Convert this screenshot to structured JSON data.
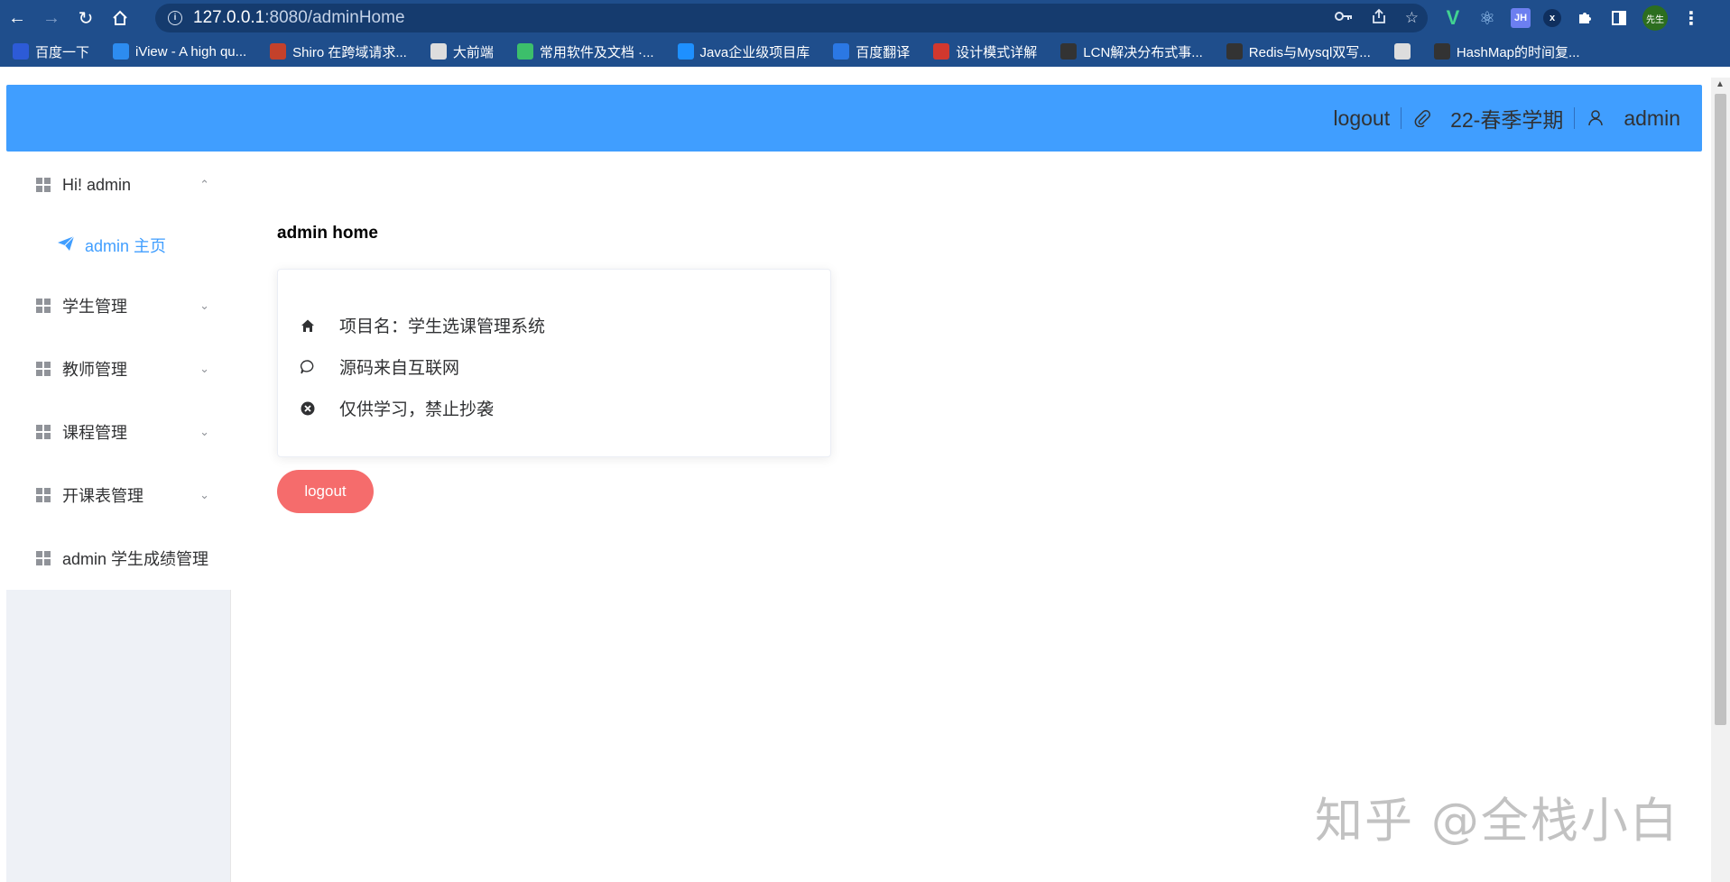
{
  "browser": {
    "url_host": "127.0.0.1",
    "url_rest": ":8080/adminHome",
    "profile_label": "先生",
    "bookmarks": [
      {
        "label": "百度一下",
        "icon": "baidu-icon",
        "color": "#2d5bd7"
      },
      {
        "label": "iView - A high qu...",
        "icon": "iview-icon",
        "color": "#2d8cf0"
      },
      {
        "label": "Shiro 在跨域请求...",
        "icon": "shiro-icon",
        "color": "#c4412b"
      },
      {
        "label": "大前端",
        "icon": "book-icon",
        "color": "#dddddd"
      },
      {
        "label": "常用软件及文档 ·...",
        "icon": "leaf-icon",
        "color": "#3cbf6b"
      },
      {
        "label": "Java企业级项目库",
        "icon": "java-icon",
        "color": "#1e90ff"
      },
      {
        "label": "百度翻译",
        "icon": "translate-icon",
        "color": "#2b78e4"
      },
      {
        "label": "设计模式详解",
        "icon": "c-icon",
        "color": "#d1382e"
      },
      {
        "label": "LCN解决分布式事...",
        "icon": "cnblogs-icon",
        "color": "#333333"
      },
      {
        "label": "Redis与Mysql双写...",
        "icon": "cnblogs-icon",
        "color": "#333333"
      },
      {
        "label": "",
        "icon": "globe-icon",
        "color": "#dddddd"
      },
      {
        "label": "HashMap的时间复...",
        "icon": "cnblogs-icon",
        "color": "#333333"
      }
    ]
  },
  "header": {
    "logout_label": "logout",
    "term_label": "22-春季学期",
    "user_label": "admin"
  },
  "sidebar": {
    "items": [
      {
        "label": "Hi! admin",
        "chevron": "up"
      },
      {
        "label": "学生管理",
        "chevron": "down"
      },
      {
        "label": "教师管理",
        "chevron": "down"
      },
      {
        "label": "课程管理",
        "chevron": "down"
      },
      {
        "label": "开课表管理",
        "chevron": "down"
      },
      {
        "label": "admin 学生成绩管理",
        "chevron": ""
      }
    ],
    "active_sub_label": "admin 主页"
  },
  "main": {
    "title": "admin home",
    "card_rows": [
      {
        "icon": "home-icon",
        "text": "项目名：学生选课管理系统"
      },
      {
        "icon": "chat-bubble-icon",
        "text": "源码来自互联网"
      },
      {
        "icon": "close-circle-icon",
        "text": "仅供学习，禁止抄袭"
      }
    ],
    "logout_button": "logout"
  },
  "watermark": "知乎 @全栈小白",
  "colors": {
    "primary": "#409eff",
    "danger": "#f56c6c",
    "chrome": "#1f4e8c"
  }
}
